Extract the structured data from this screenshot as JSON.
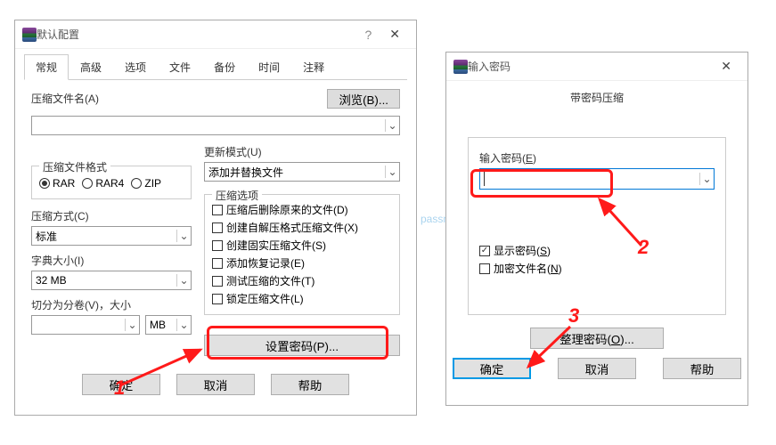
{
  "watermark": "passneo.cn",
  "dialog1": {
    "title": "默认配置",
    "help": "?",
    "close": "✕",
    "tabs": [
      "常规",
      "高级",
      "选项",
      "文件",
      "备份",
      "时间",
      "注释"
    ],
    "archive_name_label": "压缩文件名(A)",
    "browse_btn": "浏览(B)...",
    "update_mode_label": "更新模式(U)",
    "update_mode_value": "添加并替换文件",
    "format_legend": "压缩文件格式",
    "format_rar": "RAR",
    "format_rar4": "RAR4",
    "format_zip": "ZIP",
    "options_legend": "压缩选项",
    "opt_delete": "压缩后删除原来的文件(D)",
    "opt_sfx": "创建自解压格式压缩文件(X)",
    "opt_solid": "创建固实压缩文件(S)",
    "opt_recovery": "添加恢复记录(E)",
    "opt_test": "测试压缩的文件(T)",
    "opt_lock": "锁定压缩文件(L)",
    "method_label": "压缩方式(C)",
    "method_value": "标准",
    "dict_label": "字典大小(I)",
    "dict_value": "32 MB",
    "split_label": "切分为分卷(V)，大小",
    "split_unit": "MB",
    "set_password_btn": "设置密码(P)...",
    "ok": "确定",
    "cancel": "取消",
    "help_btn": "帮助"
  },
  "dialog2": {
    "title": "输入密码",
    "close": "✕",
    "subtitle": "带密码压缩",
    "input_label": "输入密码(E)",
    "show_pwd": "显示密码(S)",
    "encrypt_names": "加密文件名(N)",
    "organize_btn": "整理密码(O)...",
    "ok": "确定",
    "cancel": "取消",
    "help_btn": "帮助"
  },
  "annot": {
    "n1": "1",
    "n2": "2",
    "n3": "3"
  }
}
